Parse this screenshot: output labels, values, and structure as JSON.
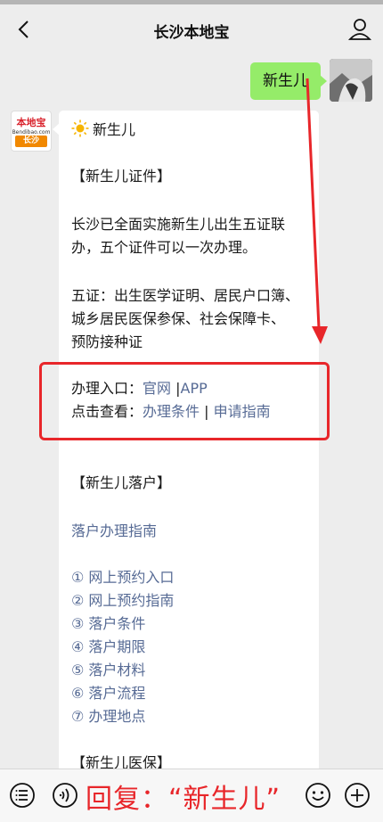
{
  "header": {
    "title": "长沙本地宝"
  },
  "user_message": {
    "text": "新生儿"
  },
  "bot": {
    "avatar": {
      "brand": "本地宝",
      "site": "Bendibao.com",
      "city": "长沙"
    },
    "lines": [
      {
        "text": "新生儿",
        "sun": true
      },
      {
        "text": "【新生儿证件】"
      },
      {
        "text": "长沙已全面实施新生儿出生五证联"
      },
      {
        "text": "办，五个证件可以一次办理。"
      },
      {
        "text": "五证：出生医学证明、居民户口簿、"
      },
      {
        "text": "城乡居民医保参保、社会保障卡、"
      },
      {
        "text": "预防接种证"
      },
      {
        "prefix": "办理入口：",
        "links": [
          "官网",
          "APP"
        ]
      },
      {
        "prefix": "点击查看：",
        "links": [
          "办理条件",
          "申请指南"
        ]
      },
      {
        "text": "【新生儿落户】"
      },
      {
        "link": "落户办理指南"
      },
      {
        "link": "① 网上预约入口"
      },
      {
        "link": "② 网上预约指南"
      },
      {
        "link": "③ 落户条件"
      },
      {
        "link": "④ 落户期限"
      },
      {
        "link": "⑤ 落户材料"
      },
      {
        "link": "⑥ 落户流程"
      },
      {
        "link": "⑦ 办理地点"
      },
      {
        "text": "【新生儿医保】"
      }
    ]
  },
  "bottom": {
    "reply_hint": "回复：“新生儿”"
  },
  "colors": {
    "accent_red": "#e8262a",
    "link": "#576b95",
    "bubble_green": "#95ec69"
  }
}
